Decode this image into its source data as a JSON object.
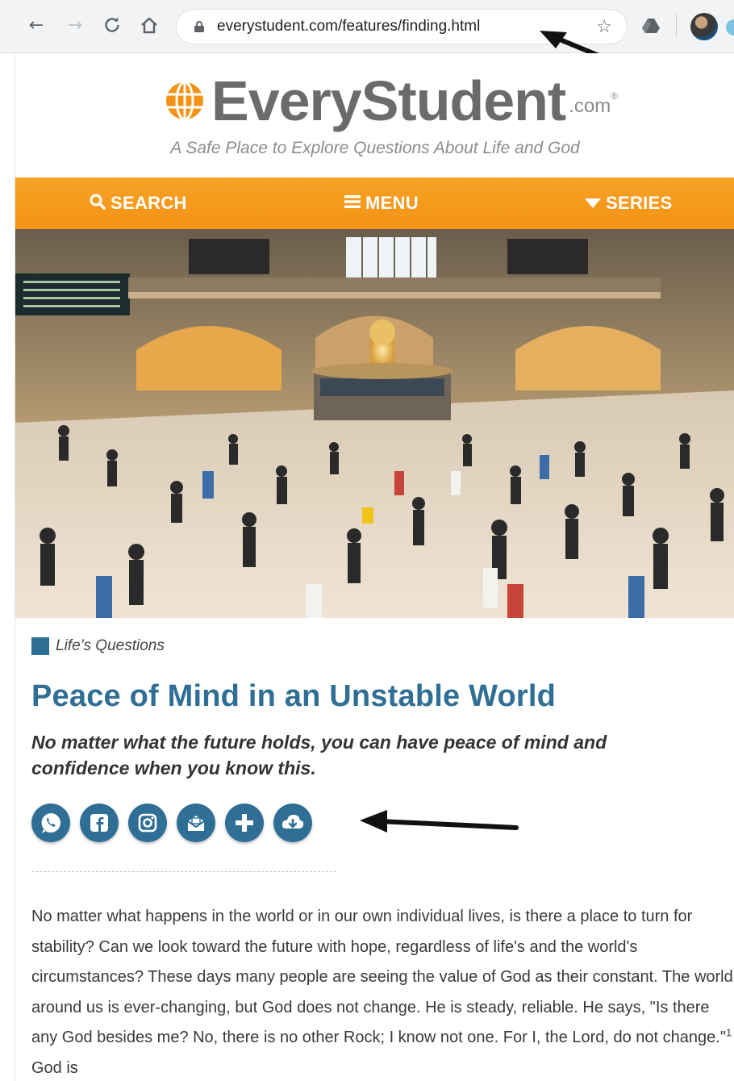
{
  "browser": {
    "url": "everystudent.com/features/finding.html",
    "icons": [
      "back-icon",
      "forward-icon",
      "reload-icon",
      "home-icon",
      "lock-icon",
      "star-icon",
      "drive-icon",
      "profile-avatar"
    ]
  },
  "site": {
    "logo_text": "EveryStudent",
    "logo_tld": ".com",
    "logo_reg": "®",
    "tagline": "A Safe Place to Explore Questions About Life and God",
    "nav": {
      "search_label": "SEARCH",
      "menu_label": "MENU",
      "series_label": "SERIES"
    },
    "colors": {
      "orange": "#f39216",
      "accent_blue": "#2f6e95"
    }
  },
  "article": {
    "category": "Life’s Questions",
    "title": "Peace of Mind in an Unstable World",
    "subtitle": "No matter what the future holds, you can have peace of mind and confidence when you know this.",
    "share_buttons": [
      "whatsapp-icon",
      "facebook-icon",
      "instagram-icon",
      "email-icon",
      "plus-icon",
      "download-icon"
    ],
    "body_before_footnote": "No matter what happens in the world or in our own individual lives, is there a place to turn for stability? Can we look toward the future with hope, regardless of life's and the world's circumstances? These days many people are seeing the value of God as their constant. The world around us is ever-changing, but God does not change. He is steady, reliable. He says, \"Is there any God besides me? No, there is no other Rock; I know not one. For I, the Lord, do not change.\"",
    "footnote_marker": "1",
    "body_after_footnote": " God is"
  }
}
